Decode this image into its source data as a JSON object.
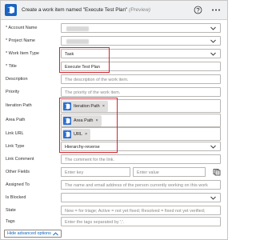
{
  "header": {
    "title": "Create a work item named \"Execute Test Plan\"",
    "preview": "(Preview)",
    "icons": [
      "azure-devops-icon",
      "help-icon",
      "more-icon"
    ]
  },
  "fields": {
    "account_name": {
      "label": "* Account Name"
    },
    "project_name": {
      "label": "* Project Name"
    },
    "work_item_type": {
      "label": "* Work Item Type",
      "value": "Task"
    },
    "title": {
      "label": "* Title",
      "value": "Execute Test Plan"
    },
    "description": {
      "label": "Description",
      "placeholder": "The description of the work item."
    },
    "priority": {
      "label": "Priority",
      "placeholder": "The priority of the work item."
    },
    "iteration_path": {
      "label": "Iteration Path",
      "token": "Iteration Path",
      "remove": "×"
    },
    "area_path": {
      "label": "Area Path",
      "token": "Area Path",
      "remove": "×"
    },
    "link_url": {
      "label": "Link URL",
      "token": "URL",
      "remove": "×"
    },
    "link_type": {
      "label": "Link Type",
      "value": "Hierarchy-reverse"
    },
    "link_comment": {
      "label": "Link Comment",
      "placeholder": "The comment for the link."
    },
    "other_fields": {
      "label": "Other Fields",
      "key_placeholder": "Enter key",
      "value_placeholder": "Enter value"
    },
    "assigned_to": {
      "label": "Assigned To",
      "placeholder": "The name and email address of the person currently working on this work"
    },
    "is_blocked": {
      "label": "Is Blocked"
    },
    "state": {
      "label": "State",
      "placeholder": "New = for triage; Active = not yet fixed; Resolved = fixed not yet verified;"
    },
    "tags": {
      "label": "Tags",
      "placeholder": "Enter the tags separated by ';'."
    }
  },
  "advanced_button": "Hide advanced options",
  "colors": {
    "accent": "#1a63c2",
    "highlight": "#d3242f",
    "token_bg": "#e1dfdd"
  }
}
